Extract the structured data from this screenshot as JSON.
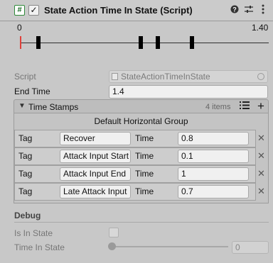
{
  "header": {
    "title": "State Action Time In State (Script)",
    "script_icon": "#",
    "enabled_check": "✓",
    "icons": [
      "help-icon",
      "presets-icon",
      "more-icon"
    ]
  },
  "timeline": {
    "start_label": "0",
    "end_label": "1.40",
    "min": 0,
    "max": 1.4,
    "markers": [
      0.1,
      0.7,
      0.8,
      1.0
    ]
  },
  "fields": {
    "script_label": "Script",
    "script_value": "StateActionTimeInState",
    "end_time_label": "End Time",
    "end_time_value": "1.4"
  },
  "time_stamps": {
    "title": "Time Stamps",
    "count": "4 items",
    "group_title": "Default Horizontal Group",
    "tag_label": "Tag",
    "time_label": "Time",
    "rows": [
      {
        "tag": "Recover",
        "time": "0.8"
      },
      {
        "tag": "Attack Input Start",
        "time": "0.1"
      },
      {
        "tag": "Attack Input End",
        "time": "1"
      },
      {
        "tag": "Late Attack Input",
        "time": "0.7"
      }
    ]
  },
  "debug": {
    "title": "Debug",
    "is_in_state_label": "Is In State",
    "time_in_state_label": "Time In State",
    "time_in_state_value": "0"
  },
  "colors": {
    "start_marker": "#e0403a",
    "script_icon": "#2f8a39"
  }
}
